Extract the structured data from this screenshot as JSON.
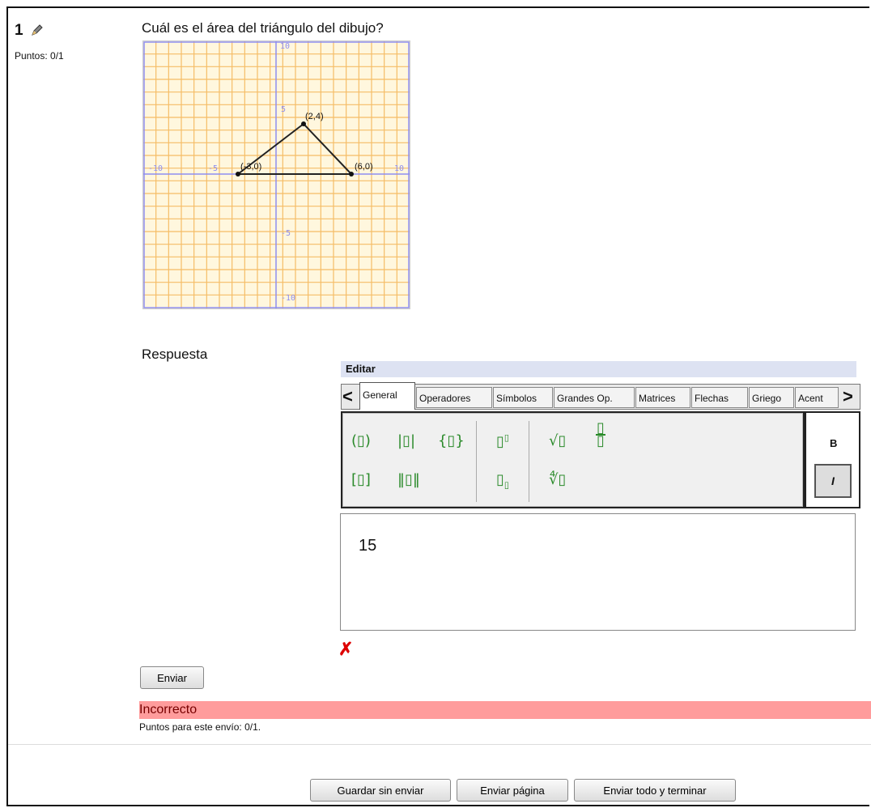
{
  "question": {
    "number": "1",
    "points_label": "Puntos: 0/1",
    "text": "Cuál es el área del triángulo del dibujo?"
  },
  "graph": {
    "tick_labels": [
      "10",
      "5",
      "-5",
      "-10"
    ],
    "x_tick_labels": [
      "-10",
      "-5",
      "10"
    ],
    "points": [
      {
        "label": "(2,4)",
        "x": 2,
        "y": 4
      },
      {
        "label": "(-3,0)",
        "x": -3,
        "y": 0
      },
      {
        "label": "(6,0)",
        "x": 6,
        "y": 0
      }
    ]
  },
  "answer": {
    "label": "Respuesta",
    "editor_title": "Editar",
    "tabs": [
      "General",
      "Operadores",
      "Símbolos",
      "Grandes Op.",
      "Matrices",
      "Flechas",
      "Griego",
      "Acent"
    ],
    "value": "15",
    "format_buttons": [
      "B",
      "I"
    ]
  },
  "buttons": {
    "submit": "Enviar",
    "save": "Guardar sin enviar",
    "send_page": "Enviar página",
    "send_all": "Enviar todo y terminar"
  },
  "feedback": {
    "status": "Incorrecto",
    "score": "Puntos para este envío: 0/1."
  }
}
